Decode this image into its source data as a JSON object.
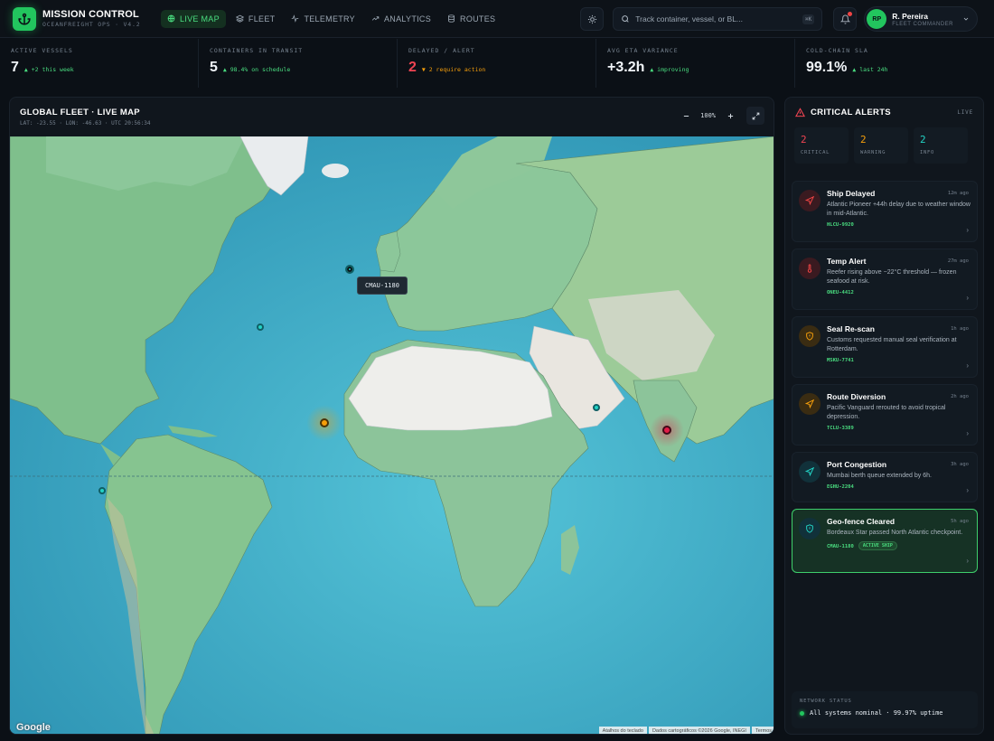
{
  "brand": {
    "title": "MISSION CONTROL",
    "subtitle": "OCEANFREIGHT OPS · V4.2"
  },
  "nav": [
    {
      "label": "LIVE MAP",
      "icon": "globe-icon",
      "active": true
    },
    {
      "label": "FLEET",
      "icon": "layers-icon"
    },
    {
      "label": "TELEMETRY",
      "icon": "pulse-icon"
    },
    {
      "label": "ANALYTICS",
      "icon": "trend-icon"
    },
    {
      "label": "ROUTES",
      "icon": "database-icon"
    }
  ],
  "search": {
    "placeholder": "Track container, vessel, or BL...",
    "shortcut": "⌘K"
  },
  "user": {
    "initials": "RP",
    "name": "R. Pereira",
    "role": "FLEET COMMANDER"
  },
  "kpis": [
    {
      "label": "ACTIVE VESSELS",
      "value": "7",
      "delta": "▲ +2 this week",
      "tone": "green"
    },
    {
      "label": "CONTAINERS IN TRANSIT",
      "value": "5",
      "delta": "▲ 98.4% on schedule",
      "tone": "green"
    },
    {
      "label": "DELAYED / ALERT",
      "value": "2",
      "delta": "▼ 2 require action",
      "tone": "orange",
      "value_tone": "red"
    },
    {
      "label": "AVG ETA VARIANCE",
      "value": "+3.2h",
      "delta": "▲ improving",
      "tone": "green"
    },
    {
      "label": "COLD-CHAIN SLA",
      "value": "99.1%",
      "delta": "▲ last 24h",
      "tone": "green"
    }
  ],
  "map": {
    "title": "GLOBAL FLEET · LIVE MAP",
    "coords": "LAT: -23.55 · LON: -46.63 · UTC 20:56:34",
    "zoom": "100%",
    "tooltip": "CMAU-1180",
    "google": "Google",
    "attribution": [
      "Atalhos do teclado",
      "Dados cartográficos ©2026 Google, INEGI",
      "Termos"
    ],
    "vessel_colors": {
      "teal": "#22d3c5",
      "orange": "#f59e0b",
      "red": "#e11d48",
      "selected": "#22d3c5"
    }
  },
  "alerts": {
    "title": "CRITICAL ALERTS",
    "live": "LIVE",
    "counts": [
      {
        "num": "2",
        "label": "CRITICAL",
        "color": "#f04452"
      },
      {
        "num": "2",
        "label": "WARNING",
        "color": "#f59e0b"
      },
      {
        "num": "2",
        "label": "INFO",
        "color": "#22d3c5"
      }
    ],
    "items": [
      {
        "title": "Ship Delayed",
        "time": "12m ago",
        "desc": "Atlantic Pioneer +44h delay due to weather window in mid-Atlantic.",
        "id": "HLCU-9920",
        "icon": "navigation-icon",
        "color": "#ef4444",
        "bg": "#3a1a20"
      },
      {
        "title": "Temp Alert",
        "time": "27m ago",
        "desc": "Reefer rising above −22°C threshold — frozen seafood at risk.",
        "id": "ONEU-4412",
        "icon": "thermometer-icon",
        "color": "#ef4444",
        "bg": "#3a1a20"
      },
      {
        "title": "Seal Re-scan",
        "time": "1h ago",
        "desc": "Customs requested manual seal verification at Rotterdam.",
        "id": "MSKU-7741",
        "icon": "shield-icon",
        "color": "#f59e0b",
        "bg": "#3a2c12"
      },
      {
        "title": "Route Diversion",
        "time": "2h ago",
        "desc": "Pacific Vanguard rerouted to avoid tropical depression.",
        "id": "TCLU-3389",
        "icon": "navigation-icon",
        "color": "#f59e0b",
        "bg": "#3a2c12"
      },
      {
        "title": "Port Congestion",
        "time": "3h ago",
        "desc": "Mumbai berth queue extended by 6h.",
        "id": "EGHU-2204",
        "icon": "navigation-icon",
        "color": "#22d3c5",
        "bg": "#11313a"
      },
      {
        "title": "Geo-fence Cleared",
        "time": "5h ago",
        "desc": "Bordeaux Star passed North Atlantic checkpoint.",
        "id": "CMAU-1180",
        "icon": "shield-icon",
        "color": "#22d3c5",
        "bg": "#11313a",
        "badge": "ACTIVE SHIP",
        "active": true
      }
    ]
  },
  "network": {
    "label": "NETWORK STATUS",
    "text": "All systems nominal · 99.97% uptime"
  }
}
